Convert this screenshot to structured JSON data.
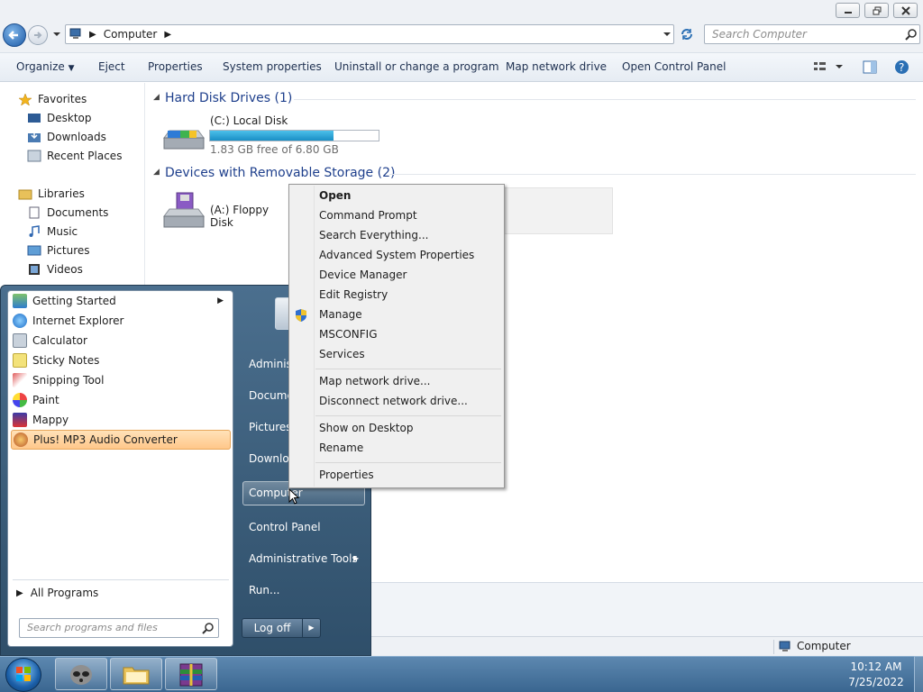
{
  "address": {
    "crumb": "Computer",
    "search_placeholder": "Search Computer"
  },
  "toolbar": {
    "organize": "Organize",
    "eject": "Eject",
    "properties": "Properties",
    "system_properties": "System properties",
    "uninstall": "Uninstall or change a program",
    "map_drive": "Map network drive",
    "open_cp": "Open Control Panel"
  },
  "nav": {
    "favorites": "Favorites",
    "desktop": "Desktop",
    "downloads": "Downloads",
    "recent": "Recent Places",
    "libraries": "Libraries",
    "documents": "Documents",
    "music": "Music",
    "pictures": "Pictures",
    "videos": "Videos"
  },
  "content": {
    "hdd_group": "Hard Disk Drives (1)",
    "local_disk": "(C:) Local Disk",
    "local_disk_free": "1.83 GB free of 6.80 GB",
    "local_disk_used_fraction": 0.73,
    "removable_group": "Devices with Removable Storage (2)",
    "floppy": "(A:) Floppy Disk"
  },
  "status": {
    "computer": "Computer"
  },
  "start_menu": {
    "programs": [
      "Getting Started",
      "Internet Explorer",
      "Calculator",
      "Sticky Notes",
      "Snipping Tool",
      "Paint",
      "Mappy",
      "Plus! MP3 Audio Converter"
    ],
    "all_programs": "All Programs",
    "search_placeholder": "Search programs and files",
    "right": {
      "admin": "Administrator",
      "documents": "Documents",
      "pictures": "Pictures",
      "downloads": "Downloads",
      "computer": "Computer",
      "control_panel": "Control Panel",
      "admin_tools": "Administrative Tools",
      "run": "Run..."
    },
    "logoff": "Log off"
  },
  "context_menu": {
    "open": "Open",
    "cmd": "Command Prompt",
    "search_everything": "Search Everything...",
    "adv_sys": "Advanced System Properties",
    "device_manager": "Device Manager",
    "edit_registry": "Edit Registry",
    "manage": "Manage",
    "msconfig": "MSCONFIG",
    "services": "Services",
    "map_drive": "Map network drive...",
    "disconnect_drive": "Disconnect network drive...",
    "show_desktop": "Show on Desktop",
    "rename": "Rename",
    "properties": "Properties"
  },
  "clock": {
    "time": "10:12 AM",
    "date": "7/25/2022"
  },
  "colors": {
    "accent": "#2a7ab0",
    "progress": "#26a0da",
    "highlight": "#ffd7a0"
  }
}
